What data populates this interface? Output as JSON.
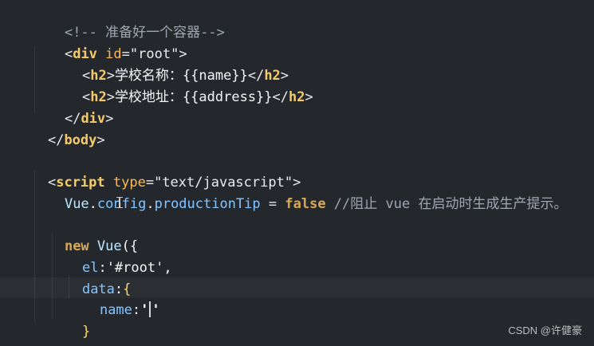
{
  "editor": {
    "lines": {
      "l0": "<!-- 准备好一个容器-->",
      "l1": {
        "open": "<",
        "tag": "div",
        "space": " ",
        "attr": "id",
        "eq": "=",
        "value": "\"root\"",
        "close": ">"
      },
      "l2": {
        "open": "<",
        "tag": "h2",
        "close": ">",
        "text": "学校名称：",
        "expr": "{{name}}",
        "end_open": "</",
        "end_tag": "h2",
        "end_close": ">"
      },
      "l3": {
        "open": "<",
        "tag": "h2",
        "close": ">",
        "text": "学校地址：",
        "expr": "{{address}}",
        "end_open": "</",
        "end_tag": "h2",
        "end_close": ">"
      },
      "l4": {
        "open": "</",
        "tag": "div",
        "close": ">"
      },
      "l5": {
        "open": "</",
        "tag": "body",
        "close": ">"
      },
      "l7": {
        "open": "<",
        "tag": "script",
        "space": " ",
        "attr": "type",
        "eq": "=",
        "value": "\"text/javascript\"",
        "close": ">"
      },
      "l8": {
        "vue": "Vue",
        "dot1": ".",
        "config": "config",
        "dot2": ".",
        "prop": "productionTip",
        "assign": " = ",
        "false": "false",
        "comment": " //阻止 vue 在启动时生成生产提示。"
      },
      "l10": {
        "new": "new",
        "space": " ",
        "vue": "Vue",
        "paren": "({"
      },
      "l11": {
        "el": "el",
        "colon": ":",
        "value": "'#root'",
        "comma": ","
      },
      "l12": {
        "data": "data",
        "colon": ":",
        "brace": "{"
      },
      "l13": {
        "name": "name",
        "colon": ":",
        "quote_open": "'",
        "quote_close": "'"
      },
      "l14": {
        "brace": "}"
      },
      "l15": {
        "close": "})"
      }
    },
    "watermark": "CSDN @许健豪"
  }
}
